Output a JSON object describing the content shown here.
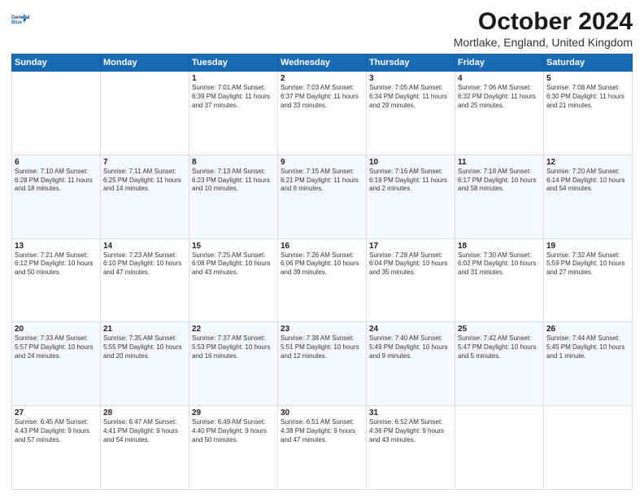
{
  "header": {
    "logo_line1": "General",
    "logo_line2": "Blue",
    "month": "October 2024",
    "location": "Mortlake, England, United Kingdom"
  },
  "days_of_week": [
    "Sunday",
    "Monday",
    "Tuesday",
    "Wednesday",
    "Thursday",
    "Friday",
    "Saturday"
  ],
  "weeks": [
    [
      {
        "day": "",
        "detail": ""
      },
      {
        "day": "",
        "detail": ""
      },
      {
        "day": "1",
        "detail": "Sunrise: 7:01 AM\nSunset: 6:39 PM\nDaylight: 11 hours\nand 37 minutes."
      },
      {
        "day": "2",
        "detail": "Sunrise: 7:03 AM\nSunset: 6:37 PM\nDaylight: 11 hours\nand 33 minutes."
      },
      {
        "day": "3",
        "detail": "Sunrise: 7:05 AM\nSunset: 6:34 PM\nDaylight: 11 hours\nand 29 minutes."
      },
      {
        "day": "4",
        "detail": "Sunrise: 7:06 AM\nSunset: 6:32 PM\nDaylight: 11 hours\nand 25 minutes."
      },
      {
        "day": "5",
        "detail": "Sunrise: 7:08 AM\nSunset: 6:30 PM\nDaylight: 11 hours\nand 21 minutes."
      }
    ],
    [
      {
        "day": "6",
        "detail": "Sunrise: 7:10 AM\nSunset: 6:28 PM\nDaylight: 11 hours\nand 18 minutes."
      },
      {
        "day": "7",
        "detail": "Sunrise: 7:11 AM\nSunset: 6:25 PM\nDaylight: 11 hours\nand 14 minutes."
      },
      {
        "day": "8",
        "detail": "Sunrise: 7:13 AM\nSunset: 6:23 PM\nDaylight: 11 hours\nand 10 minutes."
      },
      {
        "day": "9",
        "detail": "Sunrise: 7:15 AM\nSunset: 6:21 PM\nDaylight: 11 hours\nand 6 minutes."
      },
      {
        "day": "10",
        "detail": "Sunrise: 7:16 AM\nSunset: 6:19 PM\nDaylight: 11 hours\nand 2 minutes."
      },
      {
        "day": "11",
        "detail": "Sunrise: 7:18 AM\nSunset: 6:17 PM\nDaylight: 10 hours\nand 58 minutes."
      },
      {
        "day": "12",
        "detail": "Sunrise: 7:20 AM\nSunset: 6:14 PM\nDaylight: 10 hours\nand 54 minutes."
      }
    ],
    [
      {
        "day": "13",
        "detail": "Sunrise: 7:21 AM\nSunset: 6:12 PM\nDaylight: 10 hours\nand 50 minutes."
      },
      {
        "day": "14",
        "detail": "Sunrise: 7:23 AM\nSunset: 6:10 PM\nDaylight: 10 hours\nand 47 minutes."
      },
      {
        "day": "15",
        "detail": "Sunrise: 7:25 AM\nSunset: 6:08 PM\nDaylight: 10 hours\nand 43 minutes."
      },
      {
        "day": "16",
        "detail": "Sunrise: 7:26 AM\nSunset: 6:06 PM\nDaylight: 10 hours\nand 39 minutes."
      },
      {
        "day": "17",
        "detail": "Sunrise: 7:28 AM\nSunset: 6:04 PM\nDaylight: 10 hours\nand 35 minutes."
      },
      {
        "day": "18",
        "detail": "Sunrise: 7:30 AM\nSunset: 6:02 PM\nDaylight: 10 hours\nand 31 minutes."
      },
      {
        "day": "19",
        "detail": "Sunrise: 7:32 AM\nSunset: 5:59 PM\nDaylight: 10 hours\nand 27 minutes."
      }
    ],
    [
      {
        "day": "20",
        "detail": "Sunrise: 7:33 AM\nSunset: 5:57 PM\nDaylight: 10 hours\nand 24 minutes."
      },
      {
        "day": "21",
        "detail": "Sunrise: 7:35 AM\nSunset: 5:55 PM\nDaylight: 10 hours\nand 20 minutes."
      },
      {
        "day": "22",
        "detail": "Sunrise: 7:37 AM\nSunset: 5:53 PM\nDaylight: 10 hours\nand 16 minutes."
      },
      {
        "day": "23",
        "detail": "Sunrise: 7:38 AM\nSunset: 5:51 PM\nDaylight: 10 hours\nand 12 minutes."
      },
      {
        "day": "24",
        "detail": "Sunrise: 7:40 AM\nSunset: 5:49 PM\nDaylight: 10 hours\nand 9 minutes."
      },
      {
        "day": "25",
        "detail": "Sunrise: 7:42 AM\nSunset: 5:47 PM\nDaylight: 10 hours\nand 5 minutes."
      },
      {
        "day": "26",
        "detail": "Sunrise: 7:44 AM\nSunset: 5:45 PM\nDaylight: 10 hours\nand 1 minute."
      }
    ],
    [
      {
        "day": "27",
        "detail": "Sunrise: 6:45 AM\nSunset: 4:43 PM\nDaylight: 9 hours\nand 57 minutes."
      },
      {
        "day": "28",
        "detail": "Sunrise: 6:47 AM\nSunset: 4:41 PM\nDaylight: 9 hours\nand 54 minutes."
      },
      {
        "day": "29",
        "detail": "Sunrise: 6:49 AM\nSunset: 4:40 PM\nDaylight: 9 hours\nand 50 minutes."
      },
      {
        "day": "30",
        "detail": "Sunrise: 6:51 AM\nSunset: 4:38 PM\nDaylight: 9 hours\nand 47 minutes."
      },
      {
        "day": "31",
        "detail": "Sunrise: 6:52 AM\nSunset: 4:36 PM\nDaylight: 9 hours\nand 43 minutes."
      },
      {
        "day": "",
        "detail": ""
      },
      {
        "day": "",
        "detail": ""
      }
    ]
  ]
}
